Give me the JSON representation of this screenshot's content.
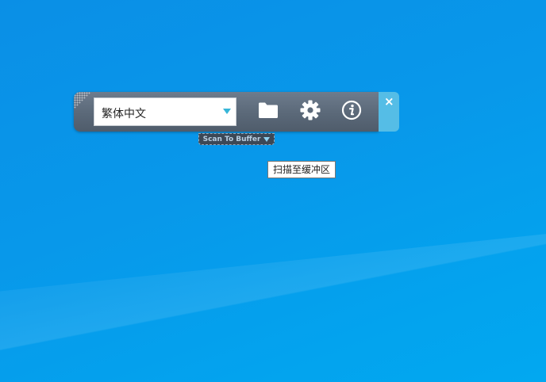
{
  "toolbar": {
    "language_select": {
      "value": "繁体中文"
    },
    "buttons": {
      "open_folder": {
        "icon": "folder-icon"
      },
      "settings": {
        "icon": "gear-icon"
      },
      "about": {
        "icon": "info-icon"
      }
    },
    "close": {
      "label": "×",
      "icon": "close-icon"
    }
  },
  "scan_mode": {
    "label": "Scan To Buffer",
    "icon": "caret-down-icon"
  },
  "tooltip": {
    "text": "扫描至缓冲区"
  },
  "colors": {
    "desktop_background": "#0898ea",
    "toolbar_body": "#5c6a7a",
    "close_tab": "#55bde6",
    "accent_caret": "#37b6d8"
  }
}
